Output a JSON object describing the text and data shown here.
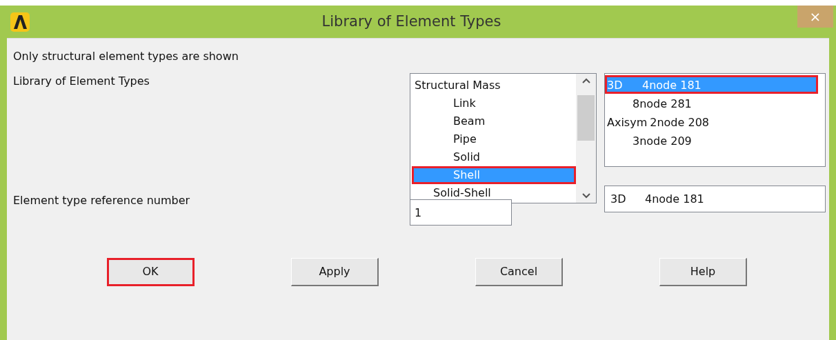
{
  "window": {
    "title": "Library of Element Types",
    "close": "×"
  },
  "note": "Only structural element types are shown",
  "library_label": "Library of Element Types",
  "category_list": {
    "items": [
      {
        "label": "Structural Mass",
        "kind": "category",
        "selected": false,
        "annotated": false,
        "children": [
          {
            "label": "Link",
            "selected": false,
            "annotated": false
          },
          {
            "label": "Beam",
            "selected": false,
            "annotated": false
          },
          {
            "label": "Pipe",
            "selected": false,
            "annotated": false
          },
          {
            "label": "Solid",
            "selected": false,
            "annotated": false
          },
          {
            "label": "Shell",
            "selected": true,
            "annotated": true
          }
        ]
      },
      {
        "label": "Solid-Shell",
        "kind": "subcategory",
        "selected": false,
        "annotated": false
      }
    ]
  },
  "type_list": {
    "items": [
      {
        "group": "3D",
        "label": "4node 181",
        "selected": true,
        "annotated": true
      },
      {
        "label": "8node 281",
        "selected": false,
        "annotated": false
      },
      {
        "group": "Axisym",
        "label": "2node 208",
        "selected": false,
        "annotated": false
      },
      {
        "label": "3node 209",
        "selected": false,
        "annotated": false
      }
    ]
  },
  "type_field": {
    "group": "3D",
    "value": "4node 181"
  },
  "reference_label": "Element type reference number",
  "reference_field": {
    "value": "1"
  },
  "buttons": [
    {
      "label": "OK",
      "annotated": true
    },
    {
      "label": "Apply",
      "annotated": false
    },
    {
      "label": "Cancel",
      "annotated": false
    },
    {
      "label": "Help",
      "annotated": false
    }
  ]
}
